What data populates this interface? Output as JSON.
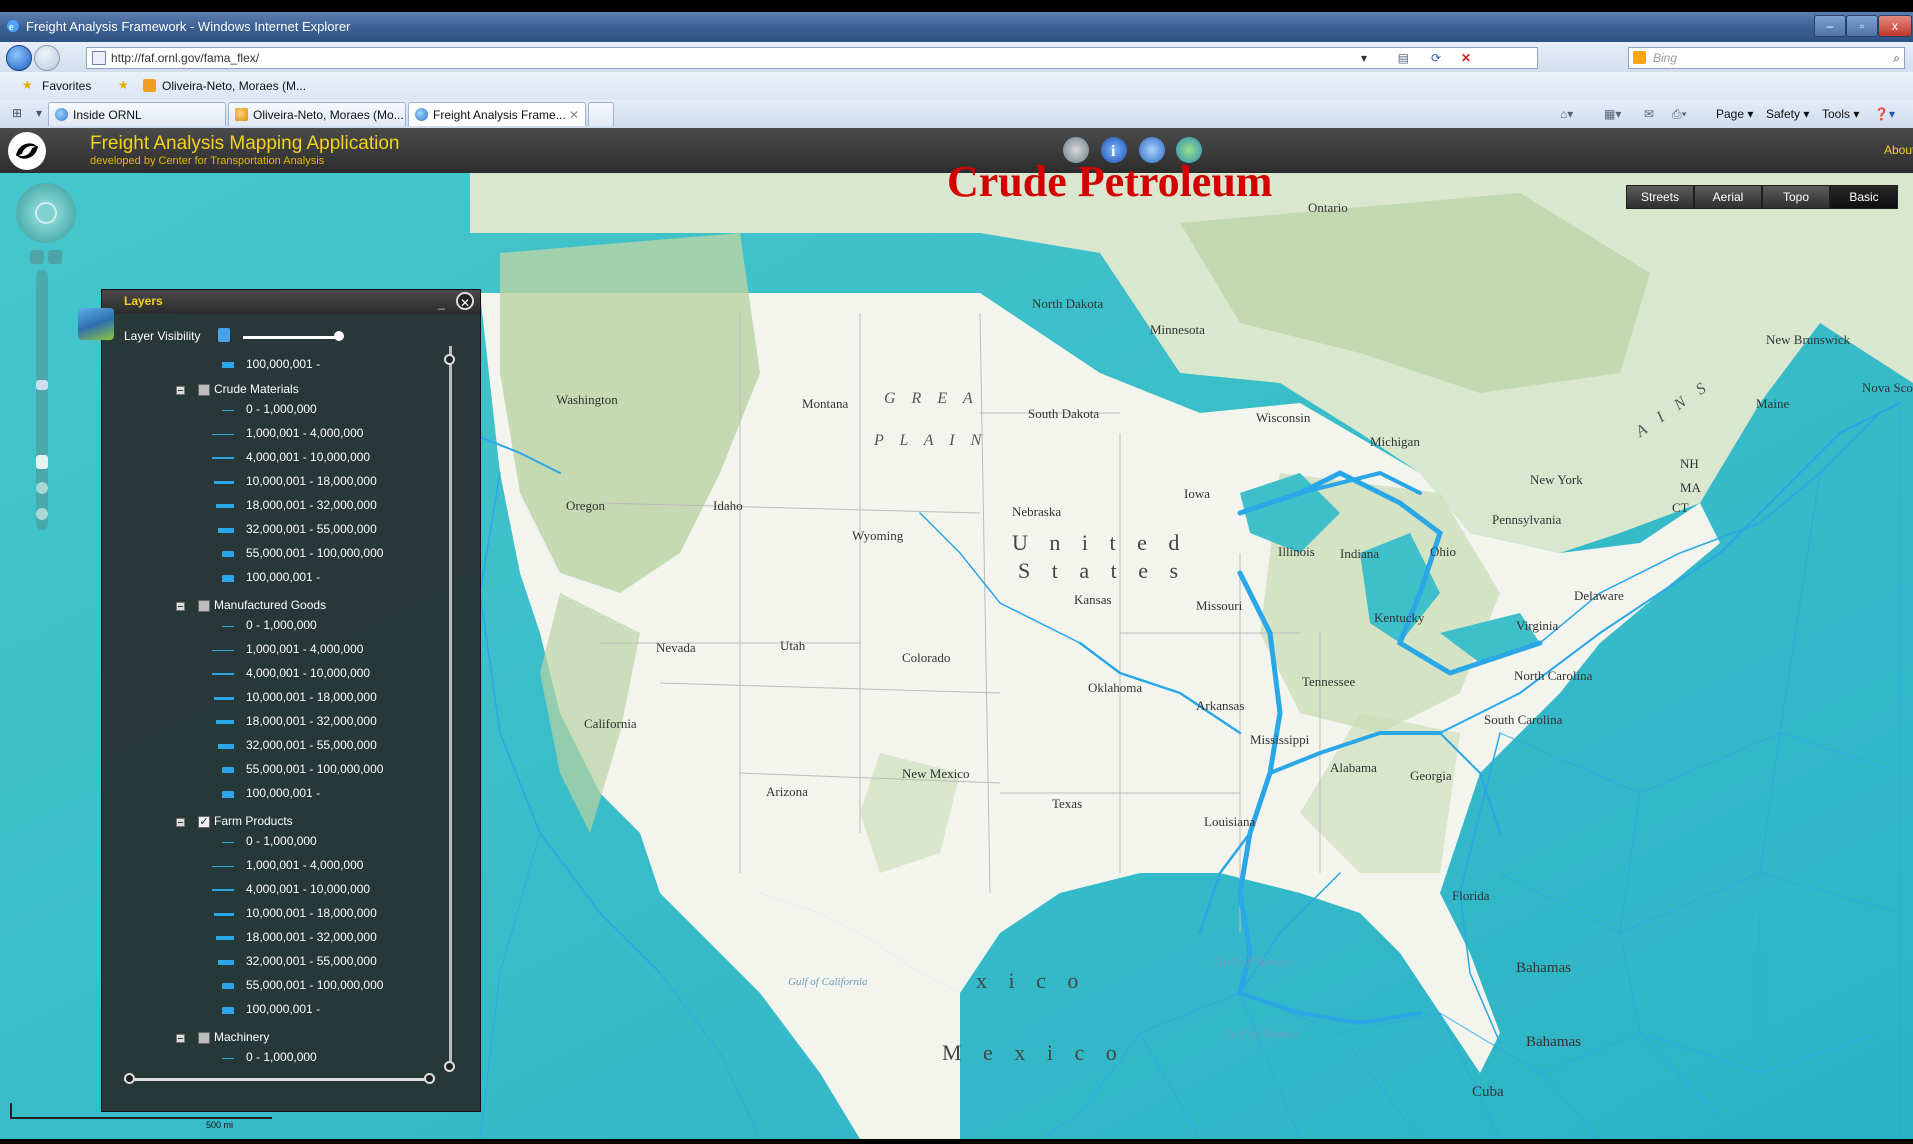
{
  "browser": {
    "window_title": "Freight Analysis Framework - Windows Internet Explorer",
    "url": "http://faf.ornl.gov/fama_flex/",
    "search_placeholder": "Bing",
    "favorites_label": "Favorites",
    "favorite_item": "Oliveira-Neto, Moraes (M...",
    "tabs": [
      {
        "label": "Inside ORNL"
      },
      {
        "label": "Oliveira-Neto, Moraes (Mo..."
      },
      {
        "label": "Freight Analysis Frame..."
      }
    ],
    "commands": {
      "page": "Page ▾",
      "safety": "Safety ▾",
      "tools": "Tools ▾"
    }
  },
  "app": {
    "title": "Freight Analysis Mapping Application",
    "subtitle": "developed by Center for Transportation Analysis",
    "about": "About"
  },
  "map": {
    "title": "Crude Petroleum",
    "basemaps": [
      "Streets",
      "Aerial",
      "Topo",
      "Basic"
    ],
    "selected_basemap": "Basic",
    "scale_label": "500 mi",
    "place_labels": {
      "ontario": "Ontario",
      "north_dakota": "North Dakota",
      "minnesota": "Minnesota",
      "south_dakota": "South Dakota",
      "montana": "Montana",
      "great_plains_1": "G R E A",
      "great_plains_2": "P L A I N",
      "washington": "Washington",
      "wisconsin": "Wisconsin",
      "michigan": "Michigan",
      "new_brunswick": "New Brunswick",
      "maine": "Maine",
      "nova_scotia": "Nova Scotia",
      "oregon": "Oregon",
      "idaho": "Idaho",
      "wyoming": "Wyoming",
      "nebraska": "Nebraska",
      "iowa": "Iowa",
      "united": "U n i t e d",
      "states": "S t a t e s",
      "illinois": "Illinois",
      "indiana": "Indiana",
      "ohio": "Ohio",
      "pennsylvania": "Pennsylvania",
      "new_york": "New York",
      "nevada": "Nevada",
      "utah": "Utah",
      "colorado": "Colorado",
      "kansas": "Kansas",
      "missouri": "Missouri",
      "kentucky": "Kentucky",
      "virginia": "Virginia",
      "california": "California",
      "oklahoma": "Oklahoma",
      "arkansas": "Arkansas",
      "tennessee": "Tennessee",
      "north_carolina": "North Carolina",
      "south_carolina": "South Carolina",
      "arizona": "Arizona",
      "new_mexico": "New Mexico",
      "texas": "Texas",
      "mississippi": "Mississippi",
      "alabama": "Alabama",
      "georgia": "Georgia",
      "louisiana": "Louisiana",
      "florida": "Florida",
      "gulf_of_mexico_1": "Gulf of Mexico",
      "gulf_of_mexico_2": "Gulf of Mexico",
      "mexico_partial": "x i c o",
      "mexico": "M e x i c o",
      "bahamas_1": "Bahamas",
      "bahamas_2": "Bahamas",
      "cuba": "Cuba",
      "delaware": "Delaware",
      "nh": "NH",
      "ma": "MA",
      "ct": "CT",
      "gulf_of_california": "Gulf of California",
      "ons": "A I N S"
    }
  },
  "layers_panel": {
    "title": "Layers",
    "visibility_label": "Layer Visibility",
    "visibility_value": 0.8,
    "top_item": "100,000,001 -",
    "groups": [
      {
        "name": "Crude Materials",
        "checked": false,
        "ranges": [
          "0 - 1,000,000",
          "1,000,001 - 4,000,000",
          "4,000,001 - 10,000,000",
          "10,000,001 - 18,000,000",
          "18,000,001 - 32,000,000",
          "32,000,001 - 55,000,000",
          "55,000,001 - 100,000,000",
          "100,000,001 -"
        ]
      },
      {
        "name": "Manufactured Goods",
        "checked": false,
        "ranges": [
          "0 - 1,000,000",
          "1,000,001 - 4,000,000",
          "4,000,001 - 10,000,000",
          "10,000,001 - 18,000,000",
          "18,000,001 - 32,000,000",
          "32,000,001 - 55,000,000",
          "55,000,001 - 100,000,000",
          "100,000,001 -"
        ]
      },
      {
        "name": "Farm Products",
        "checked": true,
        "ranges": [
          "0 - 1,000,000",
          "1,000,001 - 4,000,000",
          "4,000,001 - 10,000,000",
          "10,000,001 - 18,000,000",
          "18,000,001 - 32,000,000",
          "32,000,001 - 55,000,000",
          "55,000,001 - 100,000,000",
          "100,000,001 -"
        ]
      },
      {
        "name": "Machinery",
        "checked": false,
        "ranges": [
          "0 - 1,000,000"
        ]
      }
    ]
  },
  "colors": {
    "flow": "#2aa7e6",
    "title_red": "#d40000",
    "app_yellow": "#f3d21a",
    "ocean": "#5fcfd3",
    "land": "#f4f4ef"
  }
}
